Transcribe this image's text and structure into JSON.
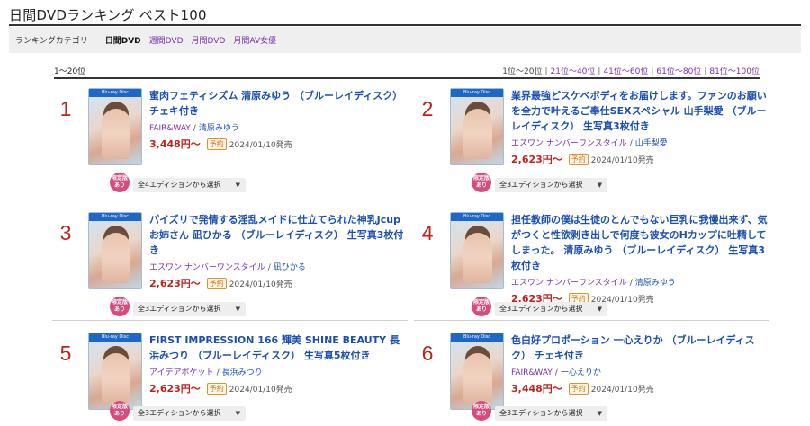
{
  "page": {
    "title": "日間DVDランキング ベスト100"
  },
  "categories": {
    "label": "ランキングカテゴリー",
    "items": [
      {
        "label": "日間DVD",
        "current": true
      },
      {
        "label": "週間DVD",
        "current": false
      },
      {
        "label": "月間DVD",
        "current": false
      },
      {
        "label": "月間AV女優",
        "current": false
      }
    ]
  },
  "range": {
    "label": "1〜20位",
    "pages": [
      {
        "label": "1位〜20位",
        "current": true
      },
      {
        "label": "21位〜40位",
        "current": false
      },
      {
        "label": "41位〜60位",
        "current": false
      },
      {
        "label": "61位〜80位",
        "current": false
      },
      {
        "label": "81位〜100位",
        "current": false
      }
    ]
  },
  "labels": {
    "limited": "限定版\nあり",
    "reserve": "予約",
    "bluray": "Blu-ray Disc"
  },
  "items": [
    {
      "rank": "1",
      "title": "蜜肉フェティシズム 清原みゆう （ブルーレイディスク） チェキ付き",
      "maker": "FAIR&WAY",
      "actress": "清原みゆう",
      "price": "3,448円〜",
      "date": "2024/01/10発売",
      "edition": "全4エディションから選択"
    },
    {
      "rank": "2",
      "title": "業界最強どスケベボディをお届けします。ファンのお願いを全力で叶えるご奉仕SEXスペシャル 山手梨愛 （ブルーレイディスク） 生写真3枚付き",
      "maker": "エスワン ナンバーワンスタイル",
      "actress": "山手梨愛",
      "price": "2,623円〜",
      "date": "2024/01/10発売",
      "edition": "全3エディションから選択"
    },
    {
      "rank": "3",
      "title": "パイズリで発情する淫乱メイドに仕立てられた神乳Jcupお姉さん 凪ひかる （ブルーレイディスク） 生写真3枚付き",
      "maker": "エスワン ナンバーワンスタイル",
      "actress": "凪ひかる",
      "price": "2,623円〜",
      "date": "2024/01/10発売",
      "edition": "全3エディションから選択"
    },
    {
      "rank": "4",
      "title": "担任教師の僕は生徒のとんでもない巨乳に我慢出来ず、気がつくと性欲剥き出しで何度も彼女のHカップに吐精してしまった。 清原みゆう （ブルーレイディスク） 生写真3枚付き",
      "maker": "エスワン ナンバーワンスタイル",
      "actress": "清原みゆう",
      "price": "2,623円〜",
      "date": "2024/01/10発売",
      "edition": "全3エディションから選択"
    },
    {
      "rank": "5",
      "title": "FIRST IMPRESSION 166 輝美 SHINE BEAUTY 長浜みつり （ブルーレイディスク） 生写真5枚付き",
      "maker": "アイデアポケット",
      "actress": "長浜みつり",
      "price": "2,623円〜",
      "date": "2024/01/10発売",
      "edition": "全3エディションから選択"
    },
    {
      "rank": "6",
      "title": "色白好プロポーション 一心えりか （ブルーレイディスク） チェキ付き",
      "maker": "FAIR&WAY",
      "actress": "一心えりか",
      "price": "3,448円〜",
      "date": "2024/01/10発売",
      "edition": "全3エディションから選択"
    }
  ]
}
